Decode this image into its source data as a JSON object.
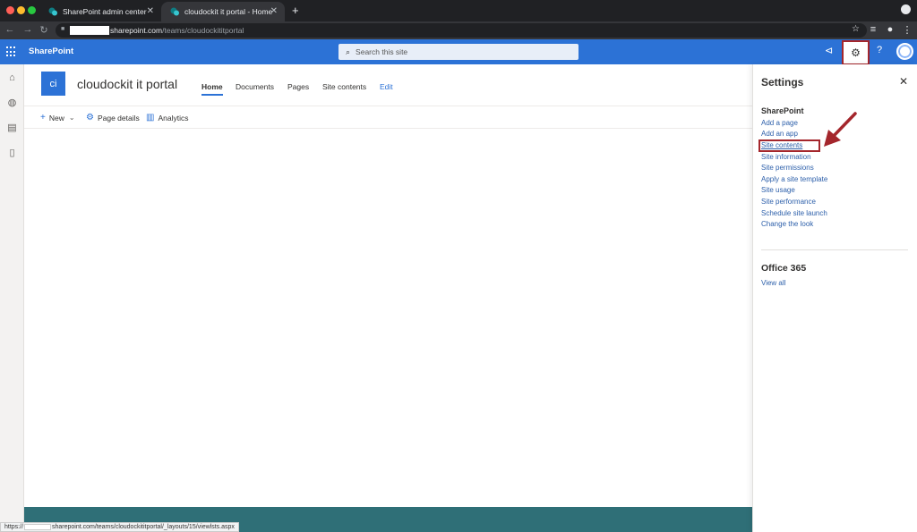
{
  "browser": {
    "tabs": [
      {
        "label": "SharePoint admin center"
      },
      {
        "label": "cloudockit it portal - Home"
      }
    ],
    "url_host": "sharepoint.com",
    "url_path": "/teams/cloudockititportal",
    "status_host": "sharepoint.com",
    "status_path": "/teams/cloudockititportal/_layouts/15/viewlsts.aspx",
    "status_prefix": "https://"
  },
  "suitebar": {
    "brand": "SharePoint",
    "search_placeholder": "Search this site"
  },
  "site": {
    "logo_text": "ci",
    "title": "cloudockit it portal",
    "nav": {
      "home": "Home",
      "documents": "Documents",
      "pages": "Pages",
      "site_contents": "Site contents",
      "edit": "Edit"
    },
    "commands": {
      "new": "New",
      "page_details": "Page details",
      "analytics": "Analytics"
    }
  },
  "settings": {
    "title": "Settings",
    "sharepoint_heading": "SharePoint",
    "links": {
      "add_page": "Add a page",
      "add_app": "Add an app",
      "site_contents": "Site contents",
      "site_information": "Site information",
      "site_permissions": "Site permissions",
      "apply_template": "Apply a site template",
      "site_usage": "Site usage",
      "site_performance": "Site performance",
      "schedule_launch": "Schedule site launch",
      "change_look": "Change the look"
    },
    "office_heading": "Office 365",
    "view_all": "View all"
  },
  "colors": {
    "suite_blue": "#2c72d6",
    "highlight_red": "#a4262c",
    "footer_teal": "#2f6f77"
  },
  "icons": {
    "gear": "gear-icon",
    "help": "help-icon",
    "megaphone": "megaphone-icon",
    "close": "close-icon"
  }
}
